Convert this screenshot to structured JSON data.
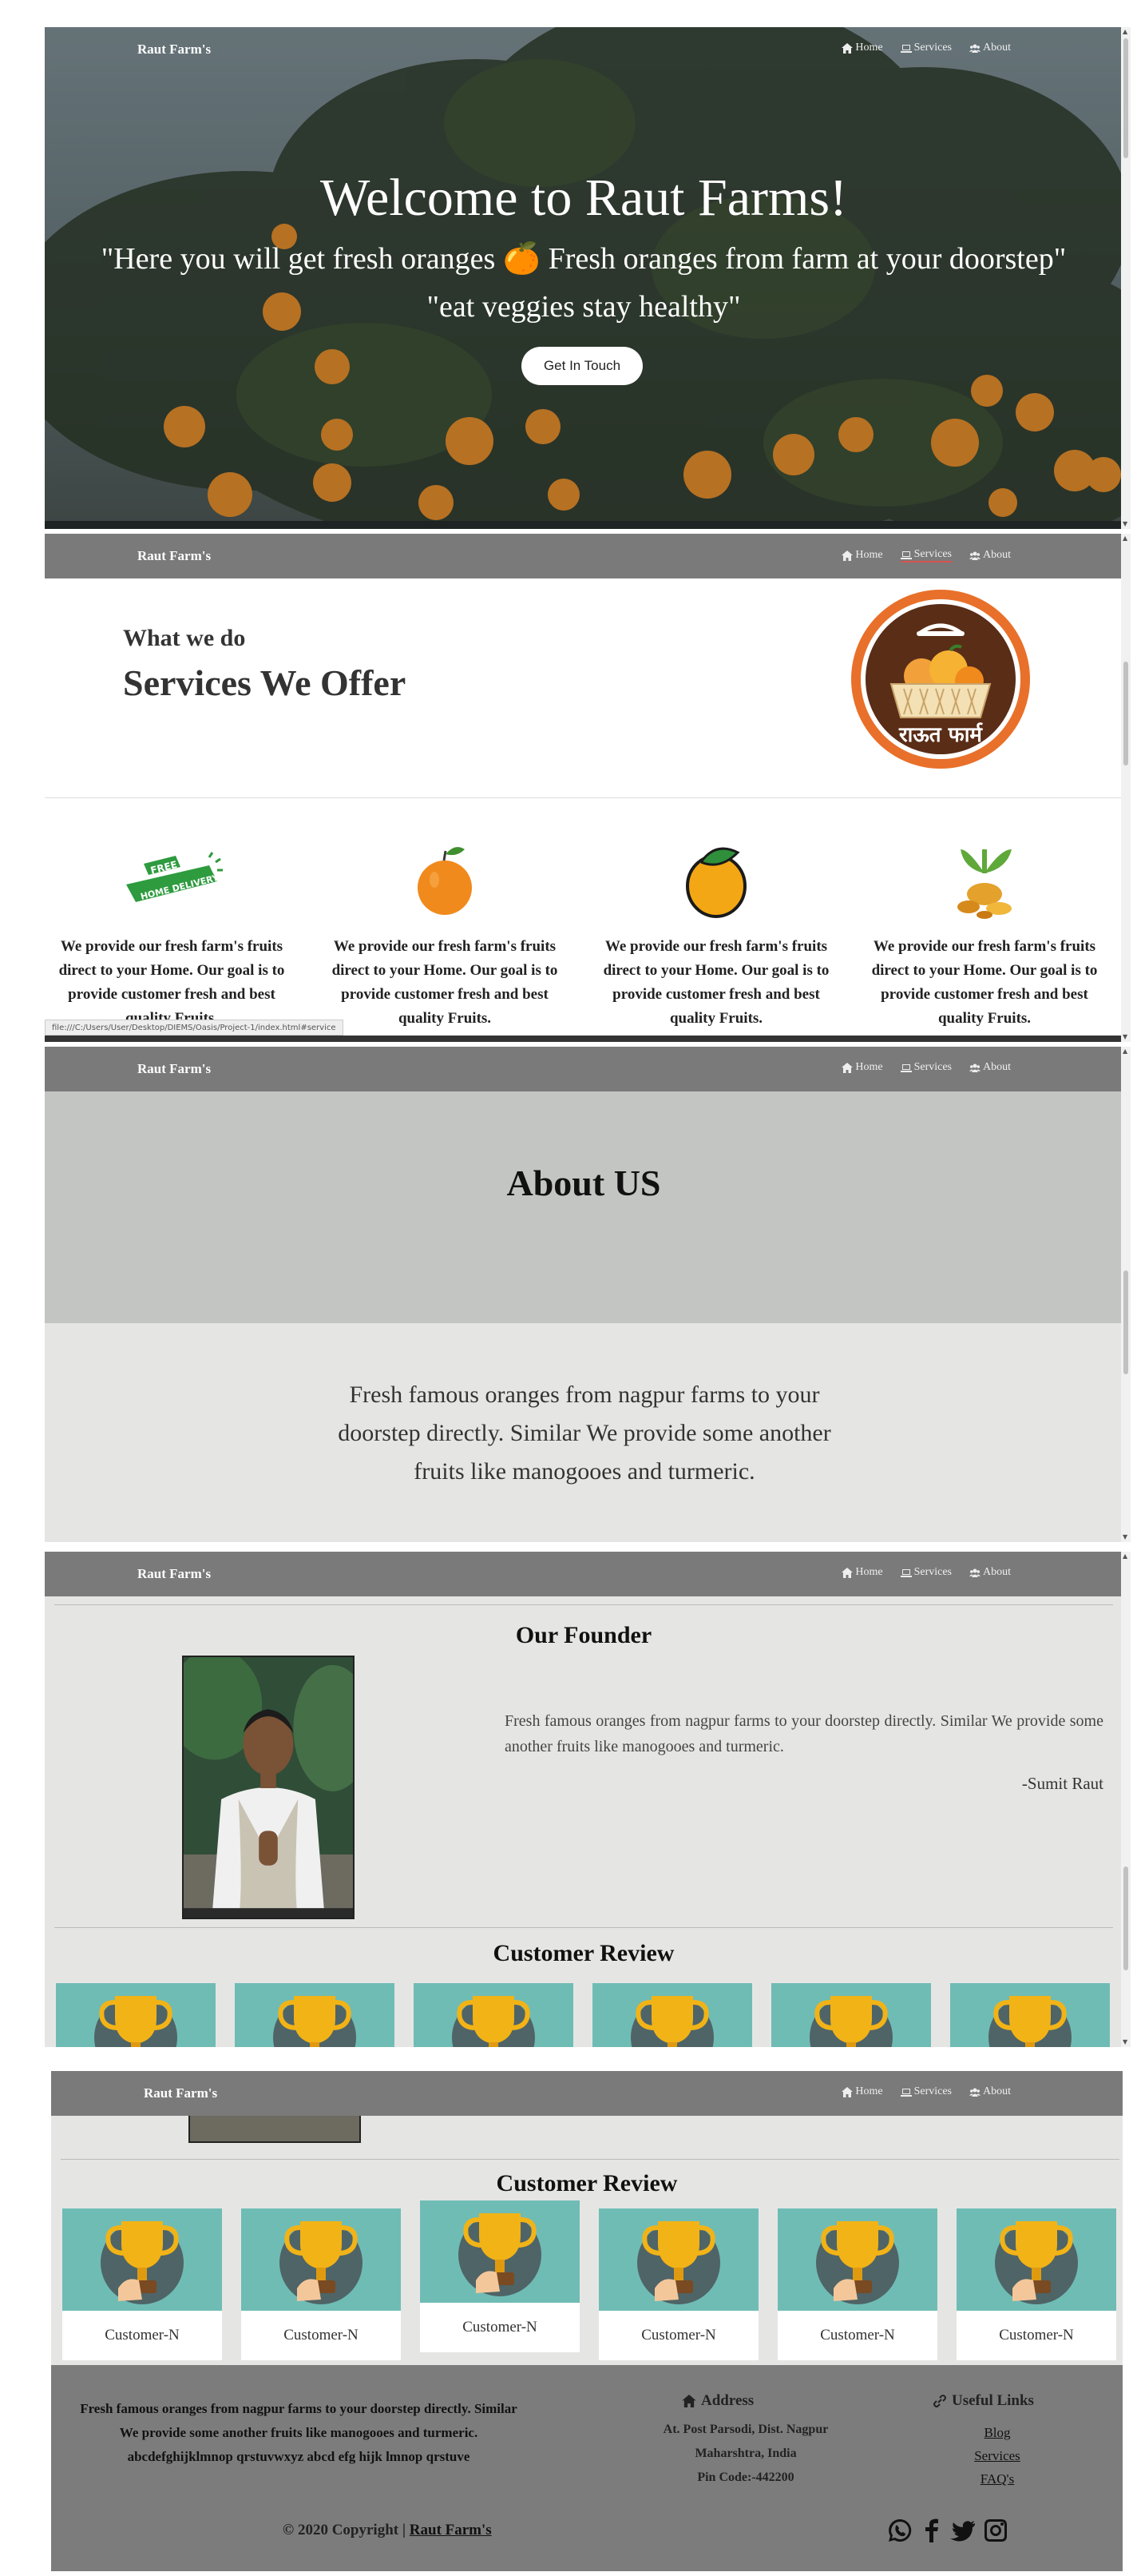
{
  "brand": "Raut Farm's",
  "nav": {
    "home": "Home",
    "services": "Services",
    "about": "About"
  },
  "hero": {
    "title": "Welcome to Raut Farms!",
    "subtitle1": "\"Here you will get fresh oranges 🍊 Fresh oranges from farm at your doorstep\"",
    "subtitle2": "\"eat veggies stay healthy\"",
    "button": "Get In Touch"
  },
  "services": {
    "kicker": "What we do",
    "title": "Services We Offer",
    "logo_text": "राऊत फार्म",
    "badge_free": "FREE",
    "badge_delivery": "HOME DELIVERY",
    "card_text": "We provide our fresh farm's fruits direct to your Home. Our goal is to provide customer fresh and best quality Fruits.",
    "cards": [
      {
        "icon": "free-home-delivery-icon"
      },
      {
        "icon": "orange-icon"
      },
      {
        "icon": "mango-icon"
      },
      {
        "icon": "turmeric-icon"
      }
    ],
    "status_url": "file:///C:/Users/User/Desktop/DIEMS/Oasis/Project-1/index.html#service"
  },
  "about": {
    "title": "About US",
    "text": "Fresh famous oranges from nagpur farms to your doorstep directly. Similar We provide some another fruits like manogooes and turmeric."
  },
  "founder": {
    "title": "Our Founder",
    "text": "Fresh famous oranges from nagpur farms to your doorstep directly. Similar We provide some another fruits like manogooes and turmeric.",
    "signature": "-Sumit Raut"
  },
  "reviews": {
    "title": "Customer Review",
    "customers": [
      "Customer-N",
      "Customer-N",
      "Customer-N",
      "Customer-N",
      "Customer-N",
      "Customer-N"
    ]
  },
  "footer": {
    "about": "Fresh famous oranges from nagpur farms to your doorstep directly. Similar We provide some another fruits like manogooes and turmeric. abcdefghijklmnop qrstuvwxyz abcd efg hijk lmnop qrstuve",
    "address_heading": "Address",
    "address_line1": "At. Post Parsodi, Dist. Nagpur",
    "address_line2": "Maharshtra, India",
    "address_line3": "Pin Code:-442200",
    "links_heading": "Useful Links",
    "links": [
      "Blog",
      "Services",
      "FAQ's"
    ],
    "copyright": "© 2020 Copyright | ",
    "copyright_link": "Raut Farm's",
    "social": [
      "whatsapp-icon",
      "facebook-icon",
      "twitter-icon",
      "instagram-icon"
    ]
  },
  "colors": {
    "navbar": "#7a7a7a",
    "about_head": "#c2c5c1",
    "page_bg": "#e5e6e4",
    "review_card": "#6fbcb5",
    "footer": "#7c7c7c",
    "orange": "#f08a1c",
    "logo_ring": "#e8702a"
  }
}
